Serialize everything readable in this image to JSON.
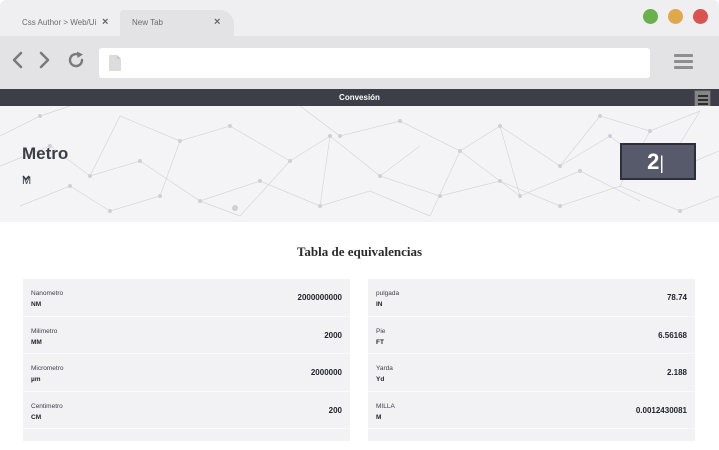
{
  "browser": {
    "tabs": [
      {
        "label": "Css Author > Web/Ui"
      },
      {
        "label": "New Tab"
      }
    ],
    "close_glyph": "×"
  },
  "page": {
    "header_title": "Convesión",
    "unit_title": "Metro",
    "unit_select": "M",
    "input_value": "2",
    "table_title": "Tabla de equivalencias",
    "left_rows": [
      {
        "name": "Nanometro",
        "abbr": "NM",
        "value": "2000000000"
      },
      {
        "name": "Milimetro",
        "abbr": "MM",
        "value": "2000"
      },
      {
        "name": "Micrometro",
        "abbr": "µm",
        "value": "2000000"
      },
      {
        "name": "Centimetro",
        "abbr": "CM",
        "value": "200"
      }
    ],
    "right_rows": [
      {
        "name": "pulgada",
        "abbr": "IN",
        "value": "78.74"
      },
      {
        "name": "Pie",
        "abbr": "FT",
        "value": "6.56168"
      },
      {
        "name": "Yarda",
        "abbr": "Yd",
        "value": "2.188"
      },
      {
        "name": "MILLA",
        "abbr": "M",
        "value": "0.0012430081"
      }
    ]
  },
  "colors": {
    "dark": "#3d3e48",
    "input_bg": "#575a6b",
    "row_bg": "#f2f2f4",
    "window_green": "#6ab04c",
    "window_yellow": "#e1a84b",
    "window_red": "#d9534f"
  },
  "icons": [
    "back-arrow-icon",
    "forward-arrow-icon",
    "reload-icon",
    "document-icon",
    "hamburger-menu-icon",
    "chevron-down-icon",
    "close-icon"
  ]
}
